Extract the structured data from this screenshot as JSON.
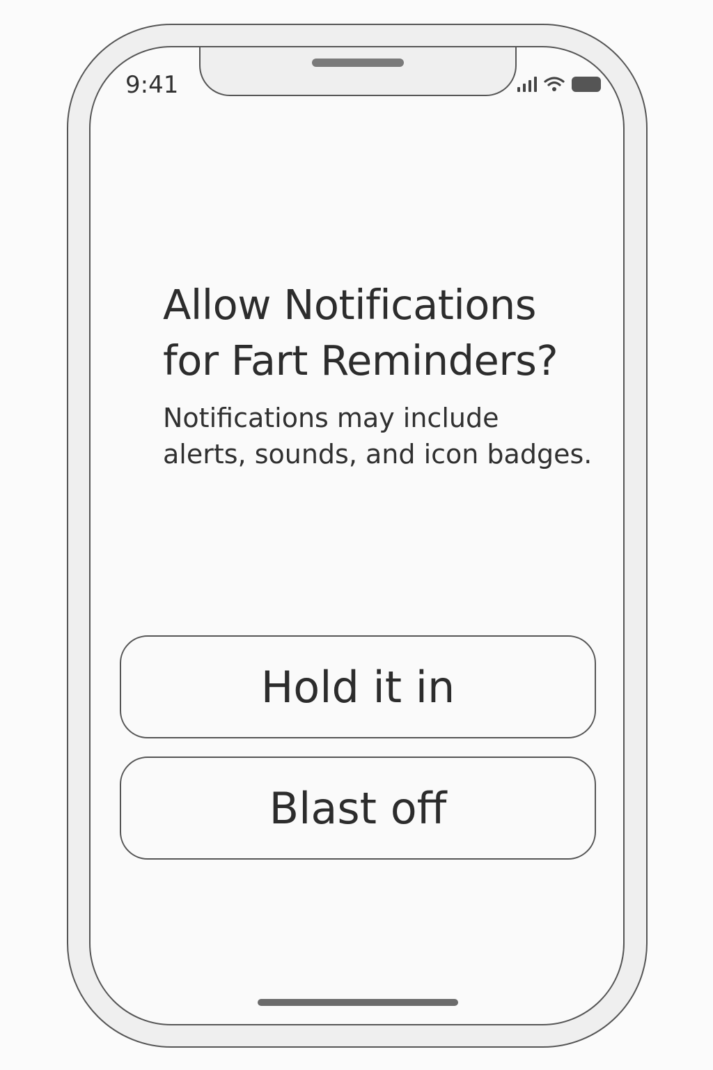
{
  "status_bar": {
    "time": "9:41",
    "icons": [
      "cellular-signal-icon",
      "wifi-icon",
      "battery-icon"
    ]
  },
  "dialog": {
    "title": "Allow Notifications for Fart Reminders?",
    "message": "Notifications may include\nalerts, sounds, and icon badges."
  },
  "buttons": {
    "hold": "Hold it in",
    "blast": "Blast off"
  },
  "colors": {
    "text": "#303030",
    "outline": "#555555",
    "frame": "#efefef",
    "screen": "#fafafa"
  }
}
